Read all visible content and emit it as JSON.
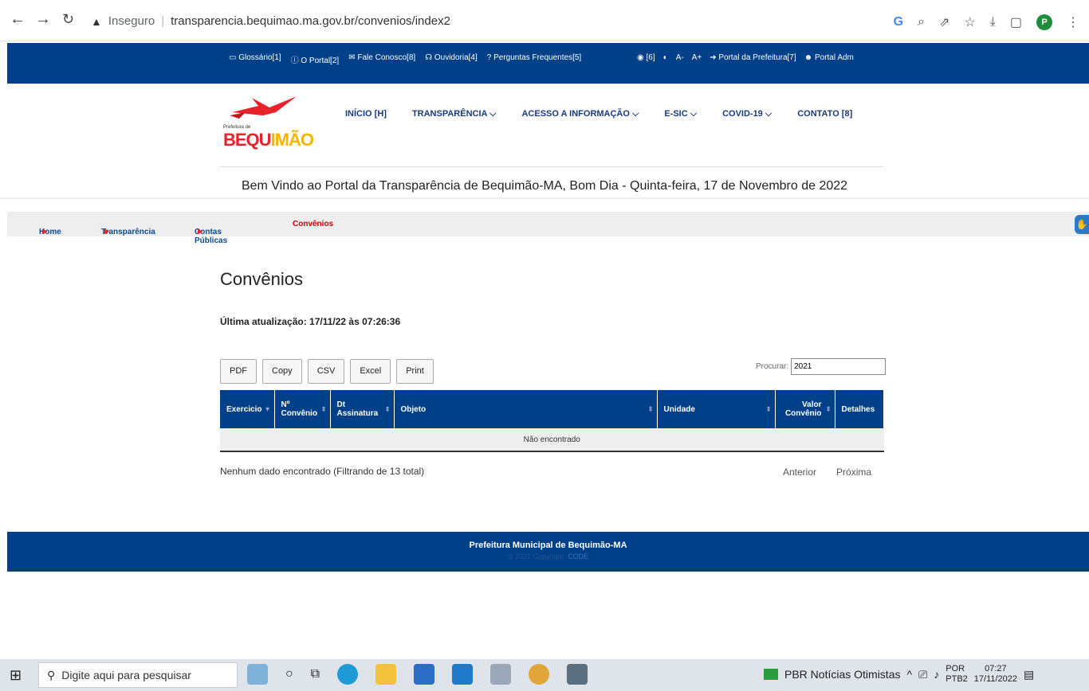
{
  "browser": {
    "back_icon": "arrow-left-icon",
    "forward_icon": "arrow-right-icon",
    "reload_icon": "reload-icon",
    "security_label": "Inseguro",
    "url": "transparencia.bequimao.ma.gov.br/convenios/index2",
    "profile_initial": "P"
  },
  "topbar": {
    "links": [
      "Glossário[1]",
      "O Portal[2]",
      "Fale Conosco[8]",
      "Ouvidoria[4]",
      "Perguntas Frequentes[5]"
    ],
    "tools": [
      "[6]",
      "A-",
      "A+",
      "Portal da Prefeitura[7]",
      "Portal Adm"
    ]
  },
  "logo": {
    "prefix": "Prefeitura de",
    "name_a": "BEQU",
    "name_b": "IMÃO"
  },
  "mainnav": [
    "INÍCIO [H]",
    "TRANSPARÊNCIA ⌵",
    "ACESSO A INFORMAÇÃO ⌵",
    "E-SIC ⌵",
    "COVID-19 ⌵",
    "CONTATO [8]"
  ],
  "welcome": "Bem Vindo ao Portal da Transparência de Bequimão-MA, Bom Dia - Quinta-feira, 17 de Novembro de 2022",
  "breadcrumb": [
    "Home",
    "Transparência",
    "Contas Públicas",
    "Convênios"
  ],
  "page": {
    "title": "Convênios",
    "updated": "Última atualização: 17/11/22 às 07:26:36"
  },
  "export_buttons": [
    "PDF",
    "Copy",
    "CSV",
    "Excel",
    "Print"
  ],
  "search": {
    "label": "Procurar:",
    "value": "2021"
  },
  "table": {
    "headers": [
      "Exercicio",
      "Nº Convênio",
      "Dt Assinatura",
      "Objeto",
      "Unidade",
      "Valor Convênio",
      "Detalhes"
    ],
    "empty": "Não encontrado"
  },
  "table_info": "Nenhum dado encontrado (Filtrando de 13 total)",
  "pager": {
    "prev": "Anterior",
    "next": "Próxima"
  },
  "footer": {
    "title": "Prefeitura Municipal de Bequimão-MA",
    "copy": "© 2021 Copyright:",
    "brand": "CODE"
  },
  "taskbar": {
    "search_placeholder": "Digite aqui para pesquisar",
    "news": "PBR Notícias Otimistas",
    "lang": "POR",
    "layout": "PTB2",
    "time": "07:27",
    "date": "17/11/2022"
  }
}
